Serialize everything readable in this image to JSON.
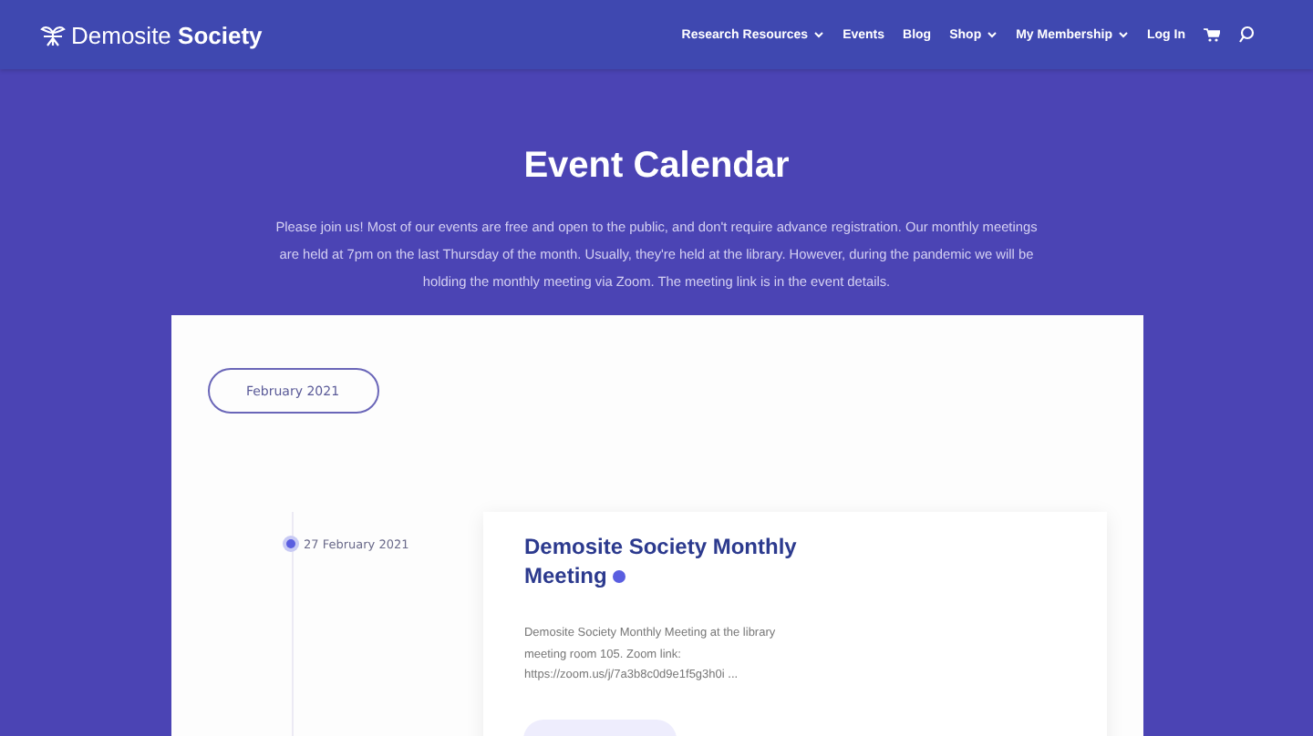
{
  "header": {
    "logo": "Demosite **Society**",
    "nav": [
      {
        "label": "Research Resources",
        "dropdown": true
      },
      {
        "label": "Events",
        "dropdown": false
      },
      {
        "label": "Blog",
        "dropdown": false
      },
      {
        "label": "Shop",
        "dropdown": true
      },
      {
        "label": "My Membership",
        "dropdown": true
      },
      {
        "label": "Log In",
        "dropdown": false
      }
    ]
  },
  "page": {
    "title": "Event Calendar",
    "intro": "Please join us! Most of our events are free and open to the public, and don't require advance registration. Our monthly meetings are held at 7pm on the last Thursday of the month. Usually, they're held at the library. However, during the pandemic we will be holding the monthly meeting via Zoom. The meeting link is in the event details."
  },
  "calendar": {
    "month": "February 2021",
    "events": [
      {
        "date": "27 February 2021",
        "title": "Demosite Society Monthly Meeting",
        "description": "Demosite Society Monthly Meeting at the library meeting room 105. Zoom link: https://zoom.us/j/7a3b8c0d9e1f5g3h0i ..."
      }
    ]
  }
}
